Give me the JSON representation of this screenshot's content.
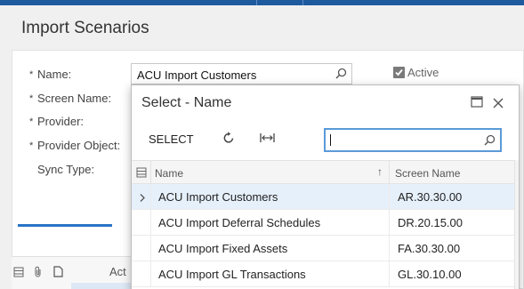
{
  "page": {
    "title": "Import Scenarios"
  },
  "form": {
    "name_label": "Name:",
    "name_value": "ACU Import Customers",
    "screen_name_label": "Screen Name:",
    "provider_label": "Provider:",
    "provider_object_label": "Provider Object:",
    "sync_type_label": "Sync Type:",
    "required_mark": "*",
    "active_label": "Active",
    "active_checked": true
  },
  "lower_grid": {
    "act_header": "Act"
  },
  "dialog": {
    "title": "Select - Name",
    "select_button": "SELECT",
    "search_value": "",
    "columns": {
      "name": "Name",
      "screen_name": "Screen Name"
    },
    "sort_indicator": "↑",
    "rows": [
      {
        "name": "ACU Import Customers",
        "screen_name": "AR.30.30.00",
        "selected": true
      },
      {
        "name": "ACU Import Deferral Schedules",
        "screen_name": "DR.20.15.00",
        "selected": false
      },
      {
        "name": "ACU Import Fixed Assets",
        "screen_name": "FA.30.30.00",
        "selected": false
      },
      {
        "name": "ACU Import GL Transactions",
        "screen_name": "GL.30.10.00",
        "selected": false
      }
    ]
  },
  "colors": {
    "accent": "#1e5a9e",
    "selection": "#e6f0fb",
    "focus_border": "#5a9ad8"
  }
}
